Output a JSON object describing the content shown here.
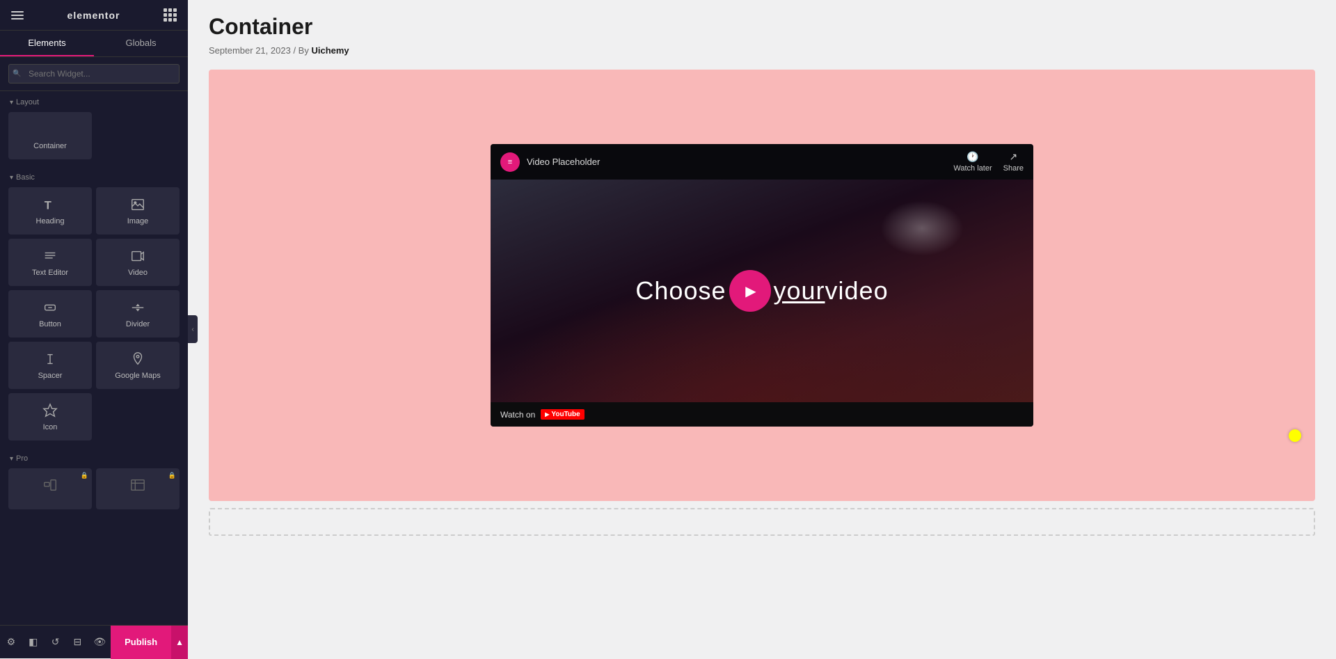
{
  "app": {
    "name": "elementor"
  },
  "sidebar": {
    "tabs": [
      {
        "id": "elements",
        "label": "Elements",
        "active": true
      },
      {
        "id": "globals",
        "label": "Globals",
        "active": false
      }
    ],
    "search": {
      "placeholder": "Search Widget..."
    },
    "sections": {
      "layout": {
        "title": "Layout",
        "widgets": [
          {
            "id": "container",
            "label": "Container",
            "icon": "container-icon"
          }
        ]
      },
      "basic": {
        "title": "Basic",
        "widgets": [
          {
            "id": "heading",
            "label": "Heading",
            "icon": "heading-icon"
          },
          {
            "id": "image",
            "label": "Image",
            "icon": "image-icon"
          },
          {
            "id": "text-editor",
            "label": "Text Editor",
            "icon": "text-editor-icon"
          },
          {
            "id": "video",
            "label": "Video",
            "icon": "video-icon"
          },
          {
            "id": "button",
            "label": "Button",
            "icon": "button-icon"
          },
          {
            "id": "divider",
            "label": "Divider",
            "icon": "divider-icon"
          },
          {
            "id": "spacer",
            "label": "Spacer",
            "icon": "spacer-icon"
          },
          {
            "id": "google-maps",
            "label": "Google Maps",
            "icon": "maps-icon"
          },
          {
            "id": "icon",
            "label": "Icon",
            "icon": "icon-icon"
          }
        ]
      },
      "pro": {
        "title": "Pro",
        "widgets": [
          {
            "id": "pro-1",
            "label": "",
            "locked": true
          },
          {
            "id": "pro-2",
            "label": "",
            "locked": true
          }
        ]
      }
    },
    "bottom": {
      "publish_label": "Publish"
    }
  },
  "main": {
    "page_title": "Container",
    "meta_date": "September 21, 2023",
    "meta_by": "By",
    "meta_author": "Uichemy",
    "video": {
      "badge_letter": "≡",
      "placeholder_text": "Video Placeholder",
      "watch_later": "Watch later",
      "share": "Share",
      "center_text_before": "Choose ",
      "center_text_underlined": "your",
      "center_text_after": " video",
      "watch_on": "Watch on",
      "youtube_label": "YouTube"
    }
  }
}
